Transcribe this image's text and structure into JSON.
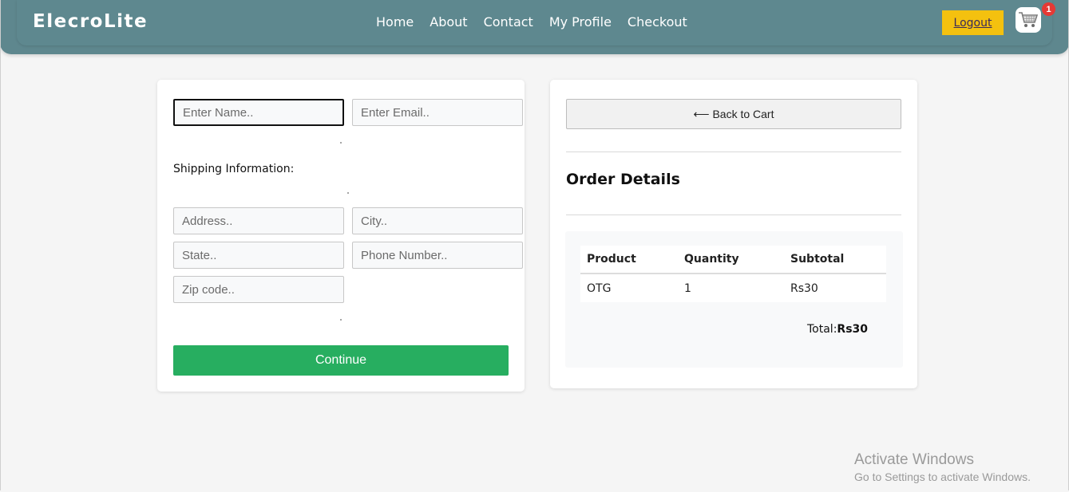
{
  "navbar": {
    "brand": "ElecroLite",
    "links": [
      {
        "label": "Home"
      },
      {
        "label": "About"
      },
      {
        "label": "Contact"
      },
      {
        "label": "My Profile"
      },
      {
        "label": "Checkout"
      }
    ],
    "logout_label": "Logout",
    "cart_icon": "shopping-cart-icon",
    "cart_count": "1"
  },
  "form": {
    "name_placeholder": "Enter Name..",
    "email_placeholder": "Enter Email..",
    "shipping_label": "Shipping Information:",
    "address_placeholder": "Address..",
    "city_placeholder": "City..",
    "state_placeholder": "State..",
    "phone_placeholder": "Phone Number..",
    "zip_placeholder": "Zip code..",
    "continue_label": "Continue"
  },
  "order": {
    "back_label": "⟵ Back to Cart",
    "title": "Order Details",
    "columns": [
      "Product",
      "Quantity",
      "Subtotal"
    ],
    "rows": [
      {
        "product": "OTG",
        "quantity": "1",
        "subtotal": "Rs30"
      }
    ],
    "total_label": "Total:",
    "total_value": "Rs30"
  },
  "watermark": {
    "title": "Activate Windows",
    "subtitle": "Go to Settings to activate Windows."
  },
  "colors": {
    "navbar": "#5e878e",
    "logout": "#f4c10f",
    "continue": "#27ae60",
    "badge": "#e53935"
  }
}
